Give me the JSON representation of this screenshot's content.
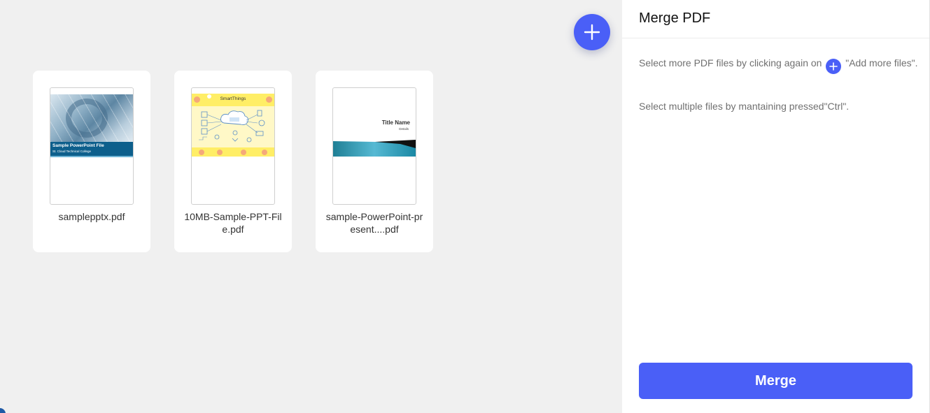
{
  "workspace": {
    "add_button_icon": "plus-icon",
    "files": [
      {
        "name": "samplepptx.pdf",
        "thumb_title": "Sample PowerPoint File",
        "thumb_subtitle": "St. Cloud Technical College"
      },
      {
        "name": "10MB-Sample-PPT-File.pdf",
        "thumb_title": "SmartThings"
      },
      {
        "name": "sample-PowerPoint-present....pdf",
        "thumb_title": "Title Name",
        "thumb_subtitle": "Details"
      }
    ]
  },
  "panel": {
    "title": "Merge PDF",
    "help_text_before": "Select more PDF files by clicking again on",
    "help_text_after": " \"Add more files\".",
    "help_text_2": "Select multiple files by mantaining pressed\"Ctrl\".",
    "merge_label": "Merge"
  },
  "colors": {
    "accent": "#4a5ff7",
    "background": "#f0f0f0",
    "panel": "#ffffff"
  }
}
